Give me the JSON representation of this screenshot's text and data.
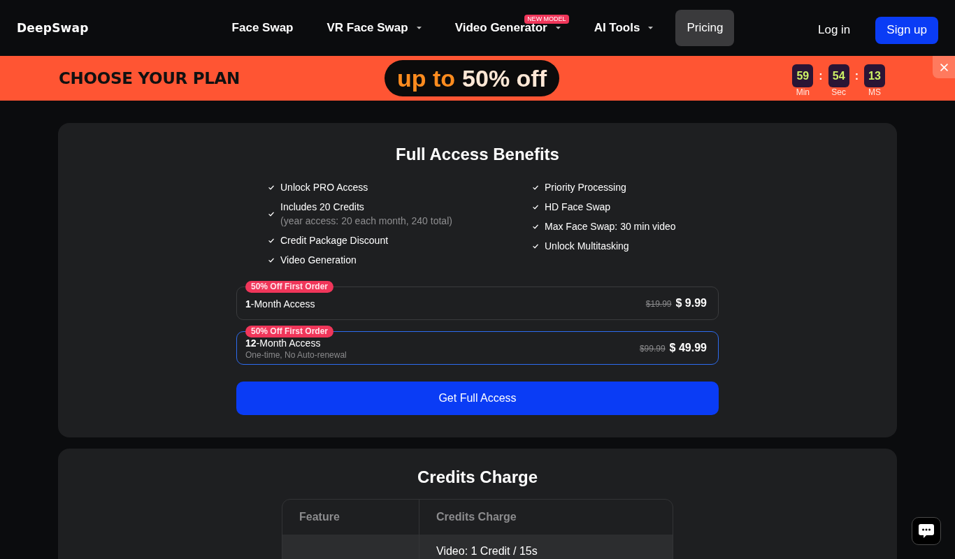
{
  "header": {
    "logo": "DeepSwap",
    "nav": [
      {
        "label": "Face Swap",
        "has_dropdown": false,
        "selected": false
      },
      {
        "label": "VR Face Swap",
        "has_dropdown": true,
        "selected": false
      },
      {
        "label": "Video Generator",
        "has_dropdown": true,
        "badge": "NEW MODEL",
        "selected": false
      },
      {
        "label": "AI Tools",
        "has_dropdown": true,
        "selected": false
      },
      {
        "label": "Pricing",
        "has_dropdown": false,
        "selected": true
      }
    ],
    "login": "Log in",
    "signup": "Sign up"
  },
  "promo_banner": {
    "title": "CHOOSE YOUR PLAN",
    "offer_prefix": "up to",
    "offer_value": "50% off",
    "countdown": {
      "segments": [
        {
          "value": "59",
          "unit": "Min"
        },
        {
          "value": "54",
          "unit": "Sec"
        },
        {
          "value": "13",
          "unit": "MS"
        }
      ],
      "separators": [
        ":",
        ":"
      ]
    },
    "closable": true
  },
  "benefits": {
    "title": "Full Access Benefits",
    "columns": [
      {
        "items": [
          {
            "text": "Unlock PRO Access"
          },
          {
            "text": "Includes 20 Credits",
            "note": "(year access: 20 each month, 240 total)"
          },
          {
            "text": "Credit Package Discount"
          },
          {
            "text": "Video Generation"
          }
        ]
      },
      {
        "items": [
          {
            "text": "Priority Processing"
          },
          {
            "text": "HD Face Swap"
          },
          {
            "text": "Max Face Swap: 30 min video"
          },
          {
            "text": "Unlock Multitasking"
          }
        ]
      }
    ]
  },
  "plans": [
    {
      "badge": "50% Off First Order",
      "name": "**1**-Month Access",
      "old_price": "$19.99",
      "price": "$ 9.99",
      "selected": false
    },
    {
      "badge": "50% Off First Order",
      "name": "**12**-Month Access",
      "note": "One-time, No Auto-renewal",
      "old_price": "$99.99",
      "price": "$ 49.99",
      "selected": true
    }
  ],
  "cta": "Get Full Access",
  "credits": {
    "title": "Credits Charge",
    "table": {
      "columns": [
        "Feature",
        "Credits Charge"
      ],
      "rows": [
        {
          "credits_charge": "Video: 1 Credit / 15s"
        }
      ]
    }
  }
}
